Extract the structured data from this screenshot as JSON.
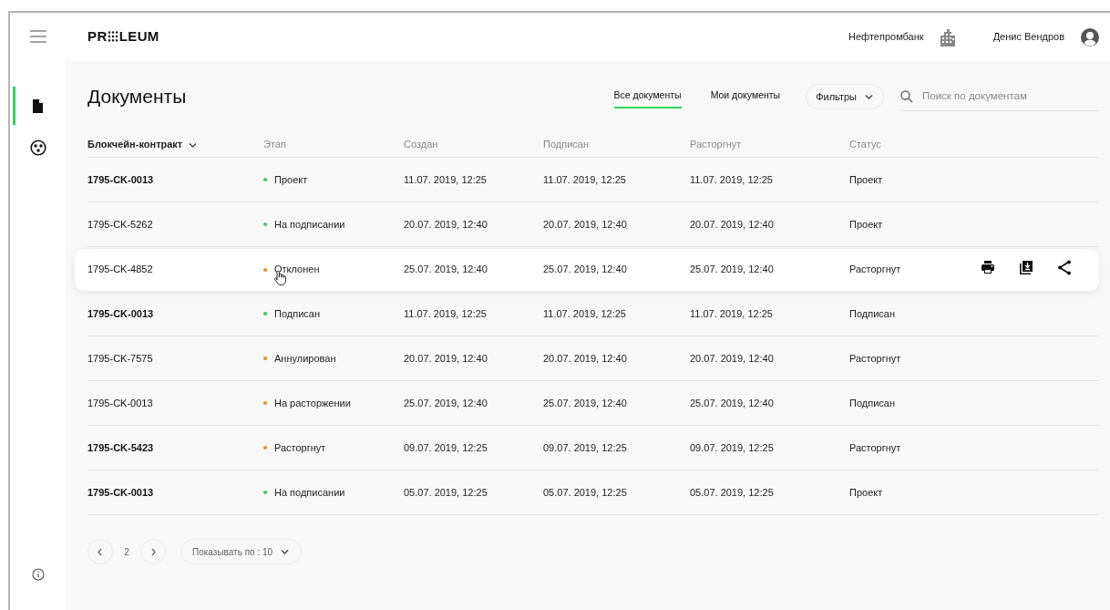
{
  "brand": "PR⁝⁝⁝LEUM",
  "header": {
    "organization": "Нефтепромбанк",
    "user": "Денис Вендров"
  },
  "sidebar": {
    "items": [
      {
        "kind": "document",
        "selected": true
      },
      {
        "kind": "network",
        "selected": false
      }
    ]
  },
  "page": {
    "title": "Документы"
  },
  "tabs": [
    {
      "label": "Все документы",
      "selected": true
    },
    {
      "label": "Мои документы",
      "selected": false
    }
  ],
  "filter": {
    "label": "Фильтры"
  },
  "search": {
    "placeholder": "Поиск по документам"
  },
  "table": {
    "columns": [
      {
        "label": "Блокчейн-контракт",
        "sorted": true
      },
      {
        "label": "Этап",
        "sorted": false
      },
      {
        "label": "Создан",
        "sorted": false
      },
      {
        "label": "Подписан",
        "sorted": false
      },
      {
        "label": "Расторгнут",
        "sorted": false
      },
      {
        "label": "Статус",
        "sorted": false
      }
    ],
    "rows": [
      {
        "contract": "1795-CK-0013",
        "bold": true,
        "hovered": false,
        "stage": "Проект",
        "color": "#3dcc5c",
        "created": "11.07. 2019, 12:25",
        "signed": "11.07. 2019, 12:25",
        "terminated": "11.07. 2019, 12:25",
        "status": "Проект"
      },
      {
        "contract": "1795-CK-5262",
        "bold": false,
        "hovered": false,
        "stage": "На подписании",
        "color": "#3dcc5c",
        "created": "20.07. 2019, 12:40",
        "signed": "20.07. 2019, 12:40",
        "terminated": "20.07. 2019, 12:40",
        "status": "Проект"
      },
      {
        "contract": "1795-CK-4852",
        "bold": false,
        "hovered": true,
        "stage": "Отклонен",
        "color": "#f08a24",
        "created": "25.07. 2019, 12:40",
        "signed": "25.07. 2019, 12:40",
        "terminated": "25.07. 2019, 12:40",
        "status": "Расторгнут"
      },
      {
        "contract": "1795-CK-0013",
        "bold": true,
        "hovered": false,
        "stage": "Подписан",
        "color": "#3dcc5c",
        "created": "11.07. 2019, 12:25",
        "signed": "11.07. 2019, 12:25",
        "terminated": "11.07. 2019, 12:25",
        "status": "Подписан"
      },
      {
        "contract": "1795-CK-7575",
        "bold": false,
        "hovered": false,
        "stage": "Аннулирован",
        "color": "#f08a24",
        "created": "20.07. 2019, 12:40",
        "signed": "20.07. 2019, 12:40",
        "terminated": "20.07. 2019, 12:40",
        "status": "Расторгнут"
      },
      {
        "contract": "1795-CK-0013",
        "bold": false,
        "hovered": false,
        "stage": "На расторжении",
        "color": "#f08a24",
        "created": "25.07. 2019, 12:40",
        "signed": "25.07. 2019, 12:40",
        "terminated": "25.07. 2019, 12:40",
        "status": "Подписан"
      },
      {
        "contract": "1795-CK-5423",
        "bold": true,
        "hovered": false,
        "stage": "Расторгнут",
        "color": "#f08a24",
        "created": "09.07. 2019, 12:25",
        "signed": "09.07. 2019, 12:25",
        "terminated": "09.07. 2019, 12:25",
        "status": "Расторгнут"
      },
      {
        "contract": "1795-CK-0013",
        "bold": true,
        "hovered": false,
        "stage": "На подписании",
        "color": "#3dcc5c",
        "created": "05.07. 2019, 12:25",
        "signed": "05.07. 2019, 12:25",
        "terminated": "05.07. 2019, 12:25",
        "status": "Проект"
      }
    ]
  },
  "pagination": {
    "page": "2",
    "page_size": "Показывать по : 10"
  }
}
